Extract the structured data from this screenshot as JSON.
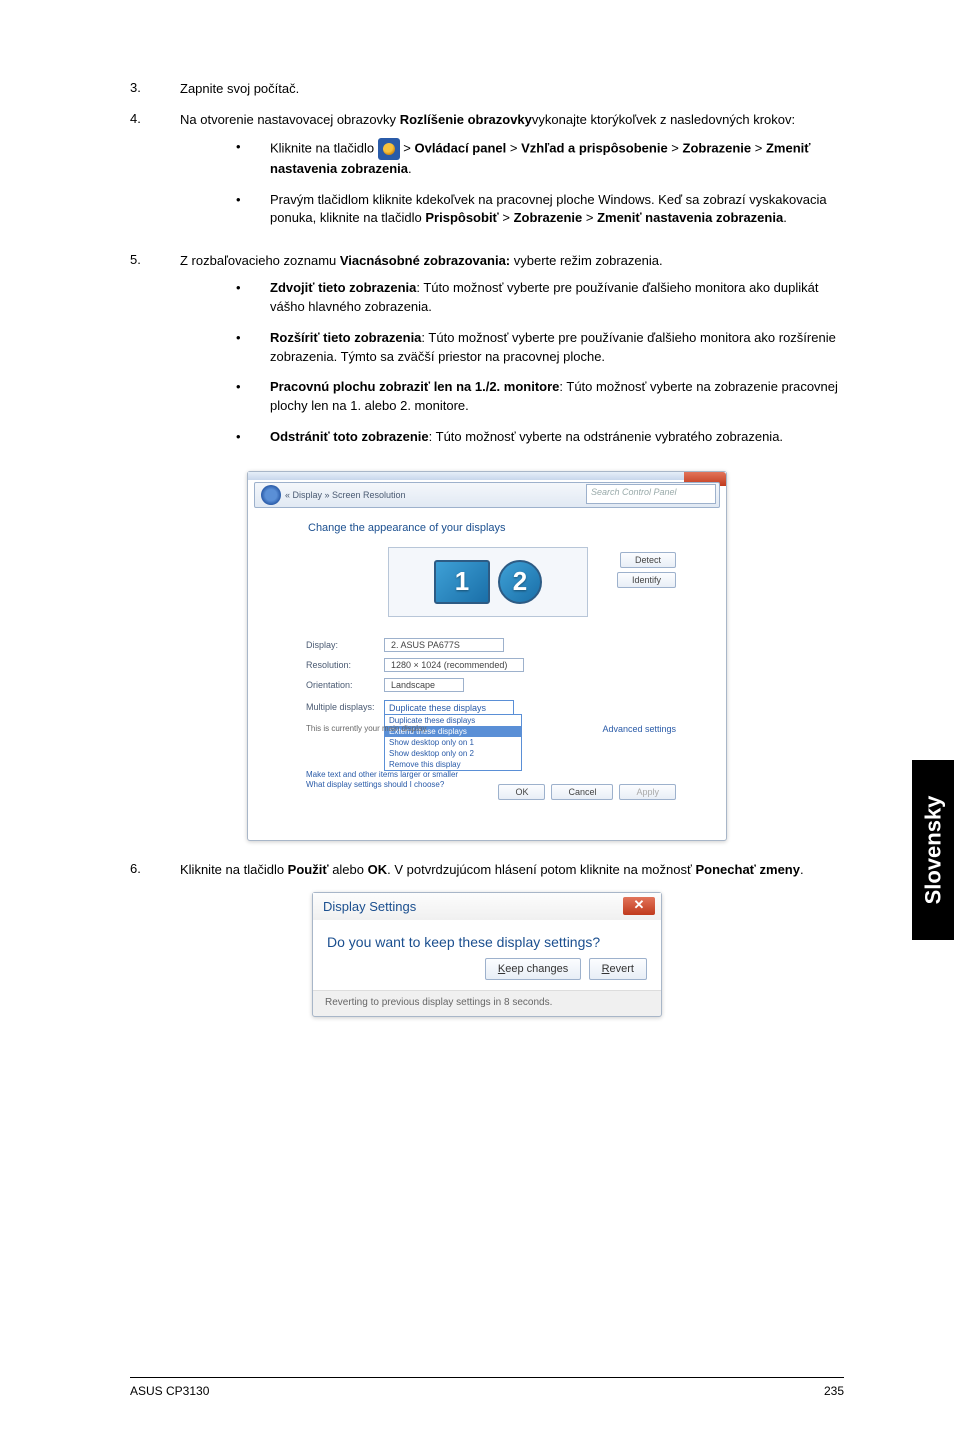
{
  "steps": {
    "s3": {
      "no": "3.",
      "text": "Zapnite svoj počítač."
    },
    "s4": {
      "no": "4.",
      "pre": "Na otvorenie nastavovacej obrazovky ",
      "bold1": "Rozlíšenie obrazovky",
      "post": "vykonajte ktorýkoľvek z nasledovných krokov:"
    },
    "s4a": {
      "pre": "Kliknite na tlačidlo ",
      "gt1": " > ",
      "b1": "Ovládací panel",
      "gt2": " > ",
      "b2": "Vzhľad a prispôsobenie",
      "gt3": " > ",
      "b3": "Zobrazenie",
      "gt4": " > ",
      "b4": "Zmeniť nastavenia zobrazenia",
      "end": "."
    },
    "s4b": {
      "pre": "Pravým tlačidlom kliknite kdekoľvek na pracovnej ploche Windows. Keď sa zobrazí vyskakovacia ponuka, kliknite na tlačidlo ",
      "b1": "Prispôsobiť",
      "gt1": " > ",
      "b2": "Zobrazenie",
      "gt2": " > ",
      "b3": "Zmeniť nastavenia zobrazenia",
      "end": "."
    },
    "s5": {
      "no": "5.",
      "pre": "Z rozbaľovacieho zoznamu ",
      "b1": "Viacnásobné zobrazovania:",
      "post": " vyberte režim zobrazenia."
    },
    "s5a": {
      "b": "Zdvojiť tieto zobrazenia",
      "t": ": Túto možnosť vyberte pre používanie ďalšieho monitora ako duplikát vášho hlavného zobrazenia."
    },
    "s5b": {
      "b": "Rozšíriť tieto zobrazenia",
      "t": ": Túto možnosť vyberte pre používanie ďalšieho monitora ako rozšírenie zobrazenia. Týmto sa zväčší priestor na pracovnej ploche."
    },
    "s5c": {
      "b": "Pracovnú plochu zobraziť len na 1./2. monitore",
      "t": ": Túto možnosť vyberte na zobrazenie pracovnej plochy len na 1. alebo 2. monitore."
    },
    "s5d": {
      "b": "Odstrániť toto zobrazenie",
      "t": ": Túto možnosť vyberte na odstránenie vybratého zobrazenia."
    },
    "s6": {
      "no": "6.",
      "pre": "Kliknite na tlačidlo ",
      "b1": "Použiť",
      "mid": " alebo ",
      "b2": "OK",
      "post1": ". V potvrdzujúcom hlásení potom kliknite na možnosť ",
      "b3": "Ponechať zmeny",
      "end": "."
    }
  },
  "screenshot1": {
    "nav_path": "« Display » Screen Resolution",
    "search_ph": "Search Control Panel",
    "heading": "Change the appearance of your displays",
    "mon1": "1",
    "mon2": "2",
    "btn_detect": "Detect",
    "btn_identify": "Identify",
    "lbl_display": "Display:",
    "val_display": "2. ASUS PA677S",
    "lbl_res": "Resolution:",
    "val_res": "1280 × 1024 (recommended)",
    "lbl_ori": "Orientation:",
    "val_ori": "Landscape",
    "lbl_multi": "Multiple displays:",
    "val_multi": "Duplicate these displays",
    "dd_opt1": "Duplicate these displays",
    "dd_opt2": "Extend these displays",
    "dd_opt3": "Show desktop only on 1",
    "dd_opt4": "Show desktop only on 2",
    "dd_opt5": "Remove this display",
    "note_main": "This is currently your main display.",
    "link_txt": "Make text and other items larger or smaller",
    "link_what": "What display settings should I choose?",
    "link_adv": "Advanced settings",
    "btn_ok": "OK",
    "btn_cancel": "Cancel",
    "btn_apply": "Apply"
  },
  "dialog": {
    "title": "Display Settings",
    "msg": "Do you want to keep these display settings?",
    "keep_u": "K",
    "keep_rest": "eep changes",
    "revert_u": "R",
    "revert_rest": "evert",
    "footer": "Reverting to previous display settings in 8 seconds."
  },
  "sidetab": "Slovensky",
  "footer": {
    "left": "ASUS CP3130",
    "right": "235"
  }
}
